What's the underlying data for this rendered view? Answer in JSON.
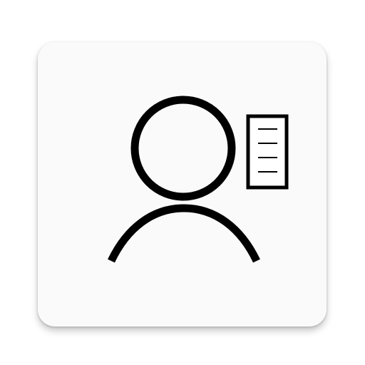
{
  "app_icon": {
    "icon_name": "user-document-icon",
    "tile_color": "#fafafa",
    "glyph_color": "#000000"
  }
}
